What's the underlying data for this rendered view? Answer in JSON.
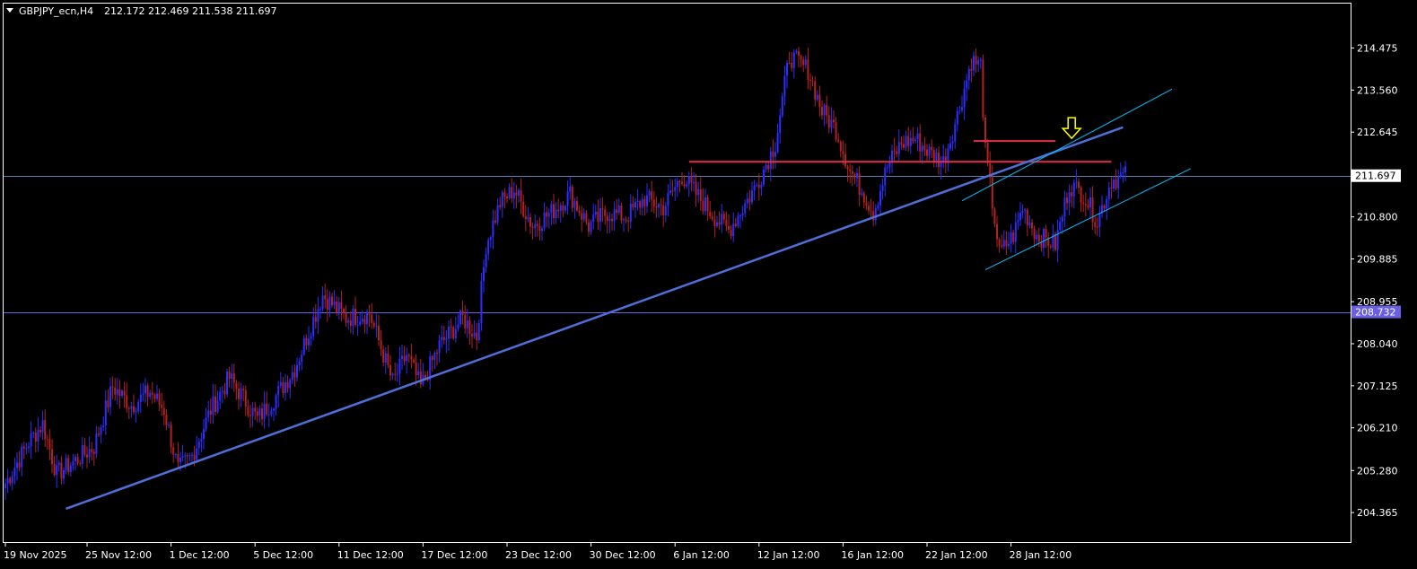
{
  "header": {
    "symbol": "GBPJPY_ecn,H4",
    "ohlc": "212.172 212.469 211.538 211.697"
  },
  "colors": {
    "background": "#000000",
    "frame": "#ffffff",
    "bull": "#2d2dff",
    "bear": "#b22222",
    "trendline": "#4f6fd8",
    "resistance": "#e03048",
    "channel": "#00bfff",
    "hline_current": "#5f7fb0",
    "hline_support": "#6a5fe0",
    "arrow": "#ffff00"
  },
  "chart_data": {
    "type": "candlestick",
    "ylim": [
      204.0,
      215.05
    ],
    "y_ticks": [
      "214.475",
      "213.560",
      "212.645",
      "211.697",
      "210.800",
      "209.885",
      "208.955",
      "208.732",
      "208.040",
      "207.125",
      "206.210",
      "205.280",
      "204.365"
    ],
    "x_ticks": [
      "19 Nov 2025",
      "25 Nov 12:00",
      "1 Dec 12:00",
      "5 Dec 12:00",
      "11 Dec 12:00",
      "17 Dec 12:00",
      "23 Dec 12:00",
      "30 Dec 12:00",
      "6 Jan 12:00",
      "12 Jan 12:00",
      "16 Jan 12:00",
      "22 Jan 12:00",
      "28 Jan 12:00"
    ],
    "price_path": [
      [
        0,
        205.0
      ],
      [
        10,
        205.9
      ],
      [
        16,
        206.3
      ],
      [
        22,
        205.2
      ],
      [
        30,
        205.5
      ],
      [
        38,
        205.8
      ],
      [
        46,
        207.1
      ],
      [
        54,
        206.7
      ],
      [
        62,
        207.0
      ],
      [
        68,
        206.6
      ],
      [
        74,
        205.3
      ],
      [
        80,
        205.6
      ],
      [
        88,
        206.6
      ],
      [
        96,
        207.3
      ],
      [
        100,
        207.0
      ],
      [
        108,
        206.4
      ],
      [
        116,
        206.9
      ],
      [
        124,
        207.5
      ],
      [
        136,
        209.1
      ],
      [
        146,
        208.6
      ],
      [
        156,
        208.7
      ],
      [
        166,
        207.2
      ],
      [
        172,
        207.8
      ],
      [
        178,
        207.1
      ],
      [
        186,
        208.0
      ],
      [
        196,
        208.6
      ],
      [
        202,
        208.2
      ],
      [
        206,
        210.2
      ],
      [
        212,
        211.1
      ],
      [
        218,
        211.4
      ],
      [
        226,
        210.6
      ],
      [
        234,
        210.9
      ],
      [
        242,
        211.3
      ],
      [
        250,
        210.6
      ],
      [
        258,
        210.9
      ],
      [
        266,
        210.8
      ],
      [
        274,
        211.2
      ],
      [
        282,
        211.0
      ],
      [
        290,
        211.7
      ],
      [
        296,
        211.3
      ],
      [
        304,
        210.8
      ],
      [
        310,
        210.5
      ],
      [
        316,
        211.0
      ],
      [
        322,
        211.5
      ],
      [
        330,
        212.4
      ],
      [
        336,
        214.3
      ],
      [
        344,
        214.0
      ],
      [
        350,
        213.1
      ],
      [
        356,
        212.7
      ],
      [
        362,
        211.8
      ],
      [
        368,
        211.3
      ],
      [
        372,
        210.9
      ],
      [
        378,
        211.9
      ],
      [
        384,
        212.4
      ],
      [
        390,
        212.5
      ],
      [
        396,
        212.2
      ],
      [
        402,
        212.0
      ],
      [
        408,
        213.0
      ],
      [
        414,
        214.2
      ],
      [
        418,
        214.1
      ],
      [
        420,
        212.2
      ],
      [
        426,
        210.0
      ],
      [
        432,
        210.4
      ],
      [
        436,
        211.0
      ],
      [
        442,
        210.4
      ],
      [
        450,
        210.2
      ],
      [
        456,
        211.5
      ],
      [
        462,
        211.3
      ],
      [
        468,
        210.7
      ],
      [
        474,
        211.6
      ],
      [
        480,
        211.7
      ]
    ],
    "levels": [
      {
        "price": 211.697,
        "label": "211.697",
        "role": "current"
      },
      {
        "price": 208.732,
        "label": "208.732",
        "role": "support"
      }
    ],
    "resistance_lines": [
      {
        "bars": [
          293,
          474
        ],
        "price": 212.0
      },
      {
        "bars": [
          415,
          450
        ],
        "price": 212.45
      }
    ],
    "trendline": {
      "from": [
        26,
        204.45
      ],
      "to": [
        479,
        212.75
      ]
    },
    "channel": {
      "upper": {
        "from": [
          410,
          211.15
        ],
        "to": [
          500,
          213.58
        ]
      },
      "lower": {
        "from": [
          420,
          209.65
        ],
        "to": [
          508,
          211.85
        ]
      }
    },
    "arrow_marker": {
      "bar": 457,
      "price": 212.45,
      "direction": "down"
    },
    "x_tick_bars": [
      0,
      35,
      71,
      107,
      143,
      179,
      215,
      251,
      287,
      323,
      359,
      395,
      431
    ]
  }
}
